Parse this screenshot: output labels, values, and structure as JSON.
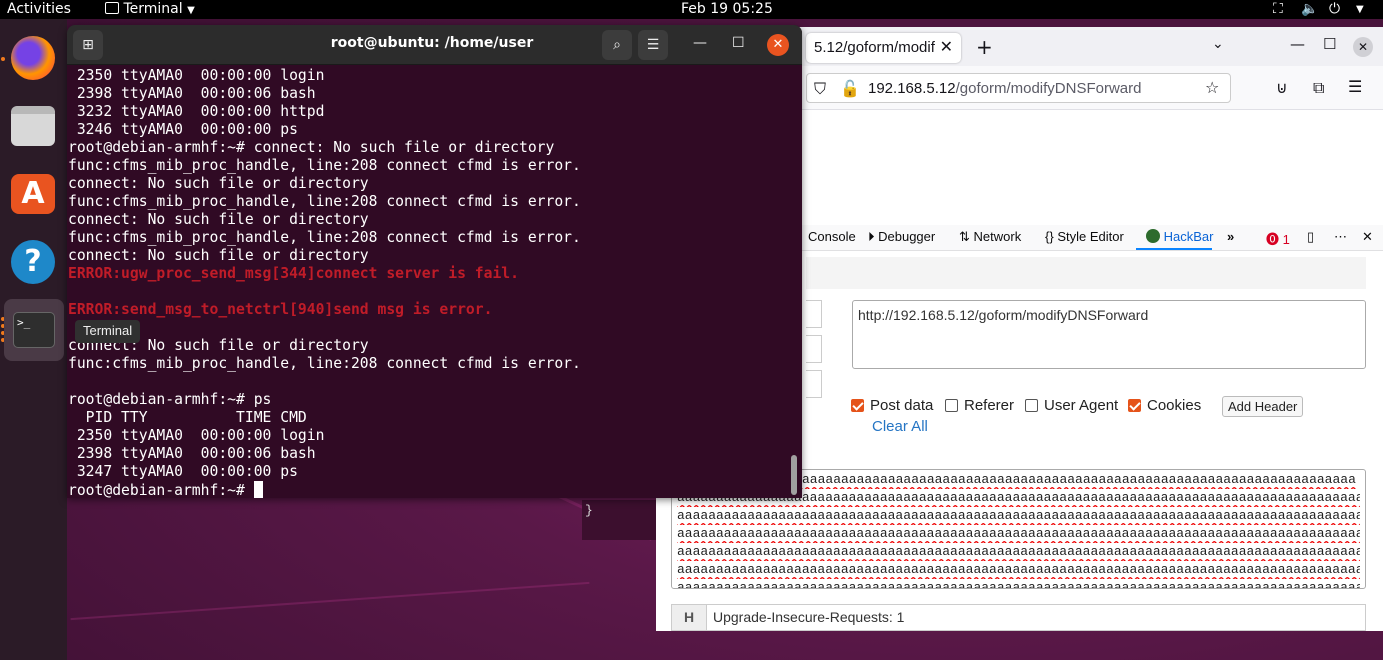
{
  "topbar": {
    "activities": "Activities",
    "app_name": "Terminal",
    "datetime": "Feb 19  05:25"
  },
  "dock": {
    "tooltip": "Terminal",
    "items": [
      "firefox-icon",
      "files-icon",
      "app-center-icon",
      "help-icon",
      "terminal-icon"
    ]
  },
  "browser": {
    "tab_title": "5.12/goform/modif",
    "url_host": "192.168.5.12",
    "url_path": "/goform/modifyDNSForward",
    "devtools_tabs": {
      "console": "Console",
      "debugger": "Debugger",
      "network": "Network",
      "style_editor": "Style Editor",
      "hackbar": "HackBar",
      "error_count": "1"
    },
    "hackbar": {
      "url_value": "http://192.168.5.12/goform/modifyDNSForward",
      "checkboxes": [
        {
          "label": "Post data",
          "checked": true
        },
        {
          "label": "Referer",
          "checked": false
        },
        {
          "label": "User Agent",
          "checked": false
        },
        {
          "label": "Cookies",
          "checked": true
        }
      ],
      "add_header": "Add Header",
      "clear_all": "Clear All",
      "post_body_lines": [
        "aaaaaaaaaaaaaaaaaaaaaaaaaaaaaaaaaaaaaaaaaaaaaaaaaaaaaaaaaaaaaaaaaaaaaaa",
        "aaaaaaaaaaaaaaaaaaaaaaaaaaaaaaaaaaaaaaaaaaaaaaaaaaaaaaaaaaaaaaaaaaaaaaaaaaaaaaaaaaaaaaaaaaaaaaaaaaa",
        "aaaaaaaaaaaaaaaaaaaaaaaaaaaaaaaaaaaaaaaaaaaaaaaaaaaaaaaaaaaaaaaaaaaaaaaaaaaaaaaaaaaaaaaaaaaaaaaaaaa",
        "aaaaaaaaaaaaaaaaaaaaaaaaaaaaaaaaaaaaaaaaaaaaaaaaaaaaaaaaaaaaaaaaaaaaaaaaaaaaaaaaaaaaaaaaaaaaaaaaaaa",
        "aaaaaaaaaaaaaaaaaaaaaaaaaaaaaaaaaaaaaaaaaaaaaaaaaaaaaaaaaaaaaaaaaaaaaaaaaaaaaaaaaaaaaaaaaaaaaaaaaaa",
        "aaaaaaaaaaaaaaaaaaaaaaaaaaaaaaaaaaaaaaaaaaaaaaaaaaaaaaaaaaaaaaaaaaaaaaaaaaaaaaaaaaaaaaaaaaaaaaaaaaa",
        "aaaaaaaaaaaaaaaaaaaaaaaaaaaaaaaaaaaaaaaaaaaaaaaaaaaaaaaaaaaaaaaaaaaaaaaaaaaaaaaaaaaaaaaaaaaaaaaaaaa"
      ],
      "header_tag": "H",
      "header_value": "Upgrade-Insecure-Requests: 1"
    },
    "json_brace": "}"
  },
  "terminal": {
    "title": "root@ubuntu: /home/user",
    "lines": [
      {
        "text": " 2350 ttyAMA0  00:00:00 login",
        "error": false
      },
      {
        "text": " 2398 ttyAMA0  00:00:06 bash",
        "error": false
      },
      {
        "text": " 3232 ttyAMA0  00:00:00 httpd",
        "error": false
      },
      {
        "text": " 3246 ttyAMA0  00:00:00 ps",
        "error": false
      },
      {
        "text": "root@debian-armhf:~# connect: No such file or directory",
        "error": false
      },
      {
        "text": "func:cfms_mib_proc_handle, line:208 connect cfmd is error.",
        "error": false
      },
      {
        "text": "connect: No such file or directory",
        "error": false
      },
      {
        "text": "func:cfms_mib_proc_handle, line:208 connect cfmd is error.",
        "error": false
      },
      {
        "text": "connect: No such file or directory",
        "error": false
      },
      {
        "text": "func:cfms_mib_proc_handle, line:208 connect cfmd is error.",
        "error": false
      },
      {
        "text": "connect: No such file or directory",
        "error": false
      },
      {
        "text": "ERROR:ugw_proc_send_msg[344]connect server is fail.",
        "error": true
      },
      {
        "text": "",
        "error": false
      },
      {
        "text": "ERROR:send_msg_to_netctrl[940]send msg is error.",
        "error": true
      },
      {
        "text": "",
        "error": false
      },
      {
        "text": "connect: No such file or directory",
        "error": false
      },
      {
        "text": "func:cfms_mib_proc_handle, line:208 connect cfmd is error.",
        "error": false
      },
      {
        "text": "",
        "error": false
      },
      {
        "text": "root@debian-armhf:~# ps",
        "error": false
      },
      {
        "text": "  PID TTY          TIME CMD",
        "error": false
      },
      {
        "text": " 2350 ttyAMA0  00:00:00 login",
        "error": false
      },
      {
        "text": " 2398 ttyAMA0  00:00:06 bash",
        "error": false
      },
      {
        "text": " 3247 ttyAMA0  00:00:00 ps",
        "error": false
      }
    ],
    "prompt": "root@debian-armhf:~# "
  }
}
